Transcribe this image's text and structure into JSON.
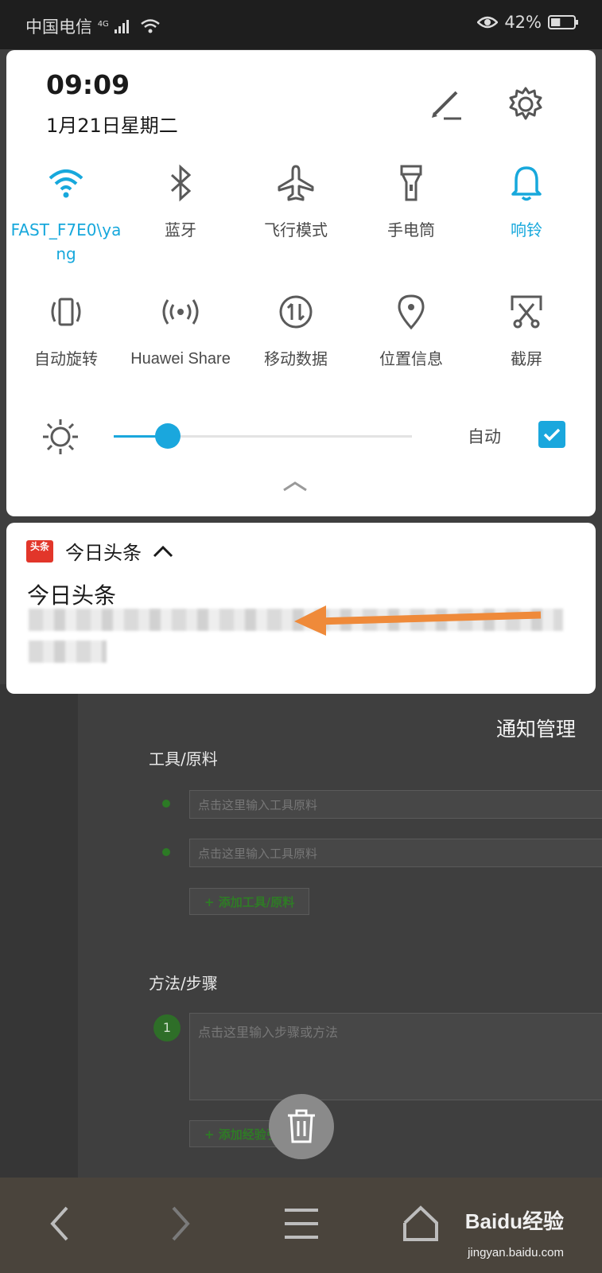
{
  "status_bar": {
    "carrier": "中国电信",
    "network": "4G",
    "battery_percent": "42%",
    "battery_level": 0.42
  },
  "quick_settings": {
    "time": "09:09",
    "date": "1月21日星期二",
    "tiles": [
      {
        "label": "FAST_F7E0\\yang",
        "icon": "wifi-icon",
        "active": true
      },
      {
        "label": "蓝牙",
        "icon": "bluetooth-icon",
        "active": false
      },
      {
        "label": "飞行模式",
        "icon": "airplane-icon",
        "active": false
      },
      {
        "label": "手电筒",
        "icon": "flashlight-icon",
        "active": false
      },
      {
        "label": "响铃",
        "icon": "bell-icon",
        "active": true
      },
      {
        "label": "自动旋转",
        "icon": "auto-rotate-icon",
        "active": false
      },
      {
        "label": "Huawei Share",
        "icon": "huawei-share-icon",
        "active": false
      },
      {
        "label": "移动数据",
        "icon": "mobile-data-icon",
        "active": false
      },
      {
        "label": "位置信息",
        "icon": "location-icon",
        "active": false
      },
      {
        "label": "截屏",
        "icon": "screenshot-icon",
        "active": false
      }
    ],
    "brightness": {
      "level": 0.18,
      "auto_label": "自动",
      "auto_checked": true
    },
    "accent_color": "#1aa7dd"
  },
  "notification": {
    "app_icon_text": "头条",
    "app_name": "今日头条",
    "title": "今日头条",
    "manage_label": "通知管理"
  },
  "background_page": {
    "tools_heading": "工具/原料",
    "tool_placeholder": "点击这里输入工具原料",
    "add_tool_label": "+ 添加工具/原料",
    "steps_heading": "方法/步骤",
    "step_number": "1",
    "step_placeholder": "点击这里输入步骤或方法",
    "add_step_label": "+ 添加经验引用"
  },
  "watermark": {
    "brand": "Baidu经验",
    "url": "jingyan.baidu.com"
  }
}
